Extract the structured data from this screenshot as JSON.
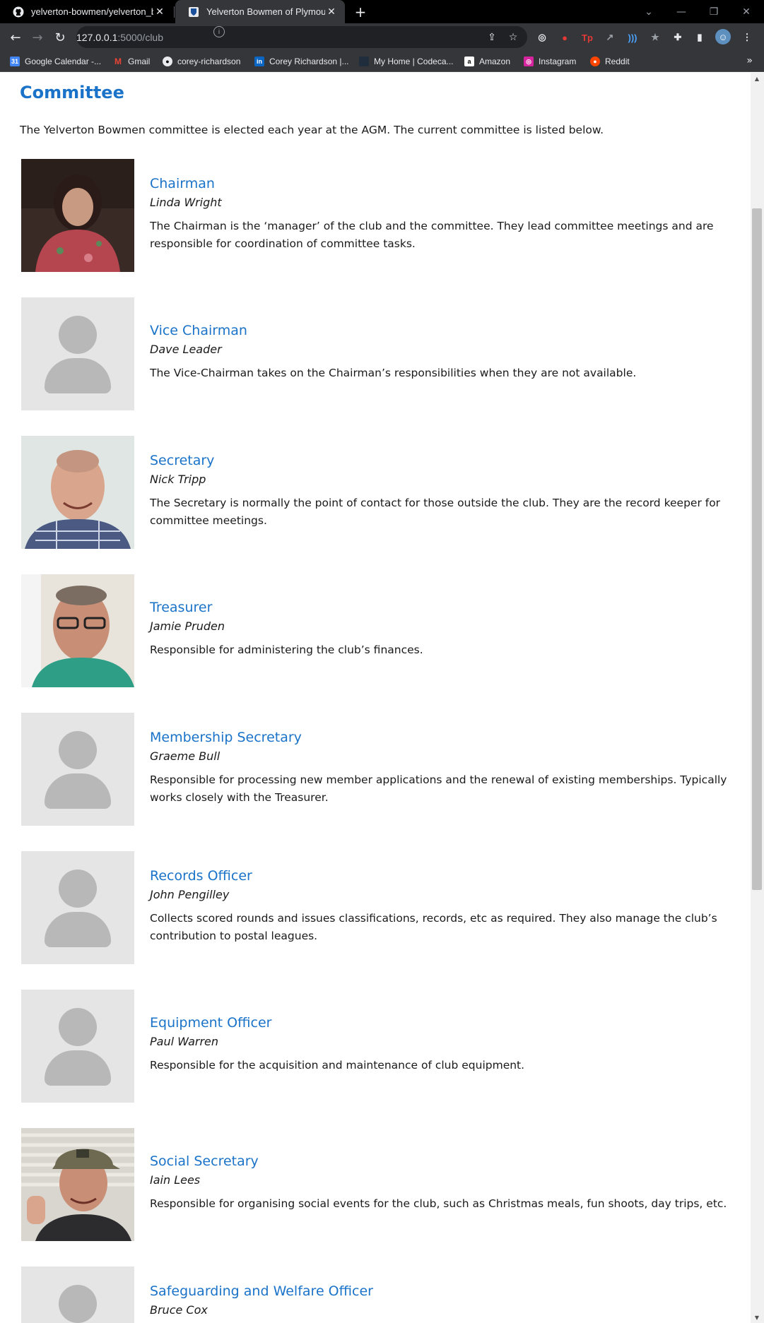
{
  "browser": {
    "tabs": [
      {
        "title": "yelverton-bowmen/yelverton_bo",
        "favicon": "github-icon",
        "active": false
      },
      {
        "title": "Yelverton Bowmen of Plymouth",
        "favicon": "shield-icon",
        "active": true
      }
    ],
    "url_host": "127.0.0.1",
    "url_path": ":5000/club",
    "bookmarks": [
      {
        "label": "Google Calendar -...",
        "icon": "calendar-icon"
      },
      {
        "label": "Gmail",
        "icon": "gmail-icon"
      },
      {
        "label": "corey-richardson",
        "icon": "github-icon"
      },
      {
        "label": "Corey Richardson |...",
        "icon": "linkedin-icon"
      },
      {
        "label": "My Home | Codeca...",
        "icon": "codecademy-icon"
      },
      {
        "label": "Amazon",
        "icon": "amazon-icon"
      },
      {
        "label": "Instagram",
        "icon": "instagram-icon"
      },
      {
        "label": "Reddit",
        "icon": "reddit-icon"
      }
    ]
  },
  "page": {
    "title": "Committee",
    "intro": "The Yelverton Bowmen committee is elected each year at the AGM. The current committee is listed below.",
    "members": [
      {
        "role": "Chairman",
        "name": "Linda Wright",
        "description": "The Chairman is the ‘manager’ of the club and the committee. They lead committee meetings and are responsible for coordination of committee tasks.",
        "photo": "photo"
      },
      {
        "role": "Vice Chairman",
        "name": "Dave Leader",
        "description": "The Vice-Chairman takes on the Chairman’s responsibilities when they are not available.",
        "photo": "placeholder"
      },
      {
        "role": "Secretary",
        "name": "Nick Tripp",
        "description": "The Secretary is normally the point of contact for those outside the club. They are the record keeper for committee meetings.",
        "photo": "photo"
      },
      {
        "role": "Treasurer",
        "name": "Jamie Pruden",
        "description": "Responsible for administering the club’s finances.",
        "photo": "photo"
      },
      {
        "role": "Membership Secretary",
        "name": "Graeme Bull",
        "description": "Responsible for processing new member applications and the renewal of existing memberships. Typically works closely with the Treasurer.",
        "photo": "placeholder"
      },
      {
        "role": "Records Officer",
        "name": "John Pengilley",
        "description": "Collects scored rounds and issues classifications, records, etc as required. They also manage the club’s contribution to postal leagues.",
        "photo": "placeholder"
      },
      {
        "role": "Equipment Officer",
        "name": "Paul Warren",
        "description": "Responsible for the acquisition and maintenance of club equipment.",
        "photo": "placeholder"
      },
      {
        "role": "Social Secretary",
        "name": "Iain Lees",
        "description": "Responsible for organising social events for the club, such as Christmas meals, fun shoots, day trips, etc.",
        "photo": "photo"
      },
      {
        "role": "Safeguarding and Welfare Officer",
        "name": "Bruce Cox",
        "description": "",
        "photo": "placeholder"
      }
    ]
  },
  "colors": {
    "accent": "#1a73c8",
    "placeholder_bg": "#e5e5e5",
    "placeholder_figure": "#b8b8b8"
  }
}
